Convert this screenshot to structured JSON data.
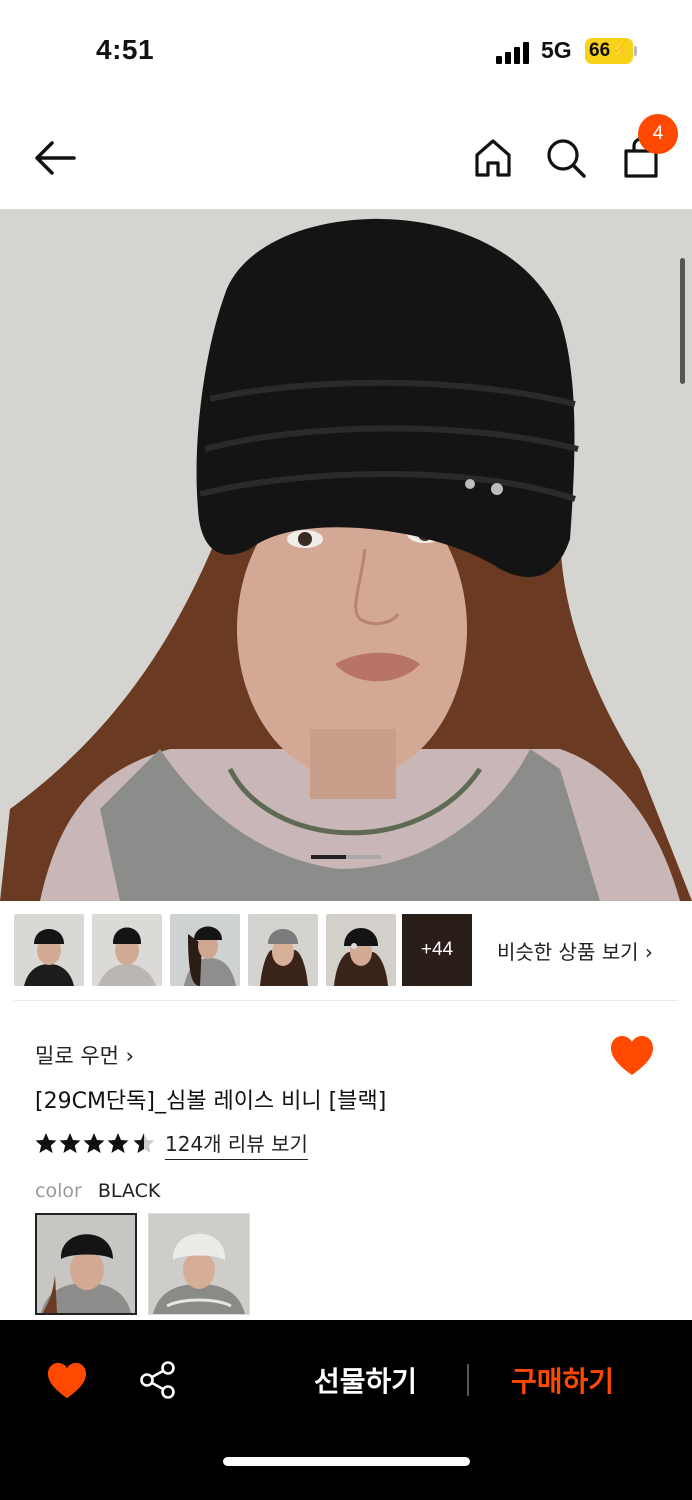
{
  "status_bar": {
    "time": "4:51",
    "network": "5G",
    "battery": "66"
  },
  "nav": {
    "cart_count": "4"
  },
  "gallery": {
    "more_count": "+44",
    "similar_label": "비슷한 상품 보기 ›"
  },
  "product": {
    "brand": "밀로 우먼 ›",
    "name": "[29CM단독]_심볼 레이스 비니 [블랙]",
    "rating": 4.5,
    "review_link": "124개 리뷰 보기",
    "color_label": "color",
    "color_value": "BLACK"
  },
  "bottom_bar": {
    "gift_label": "선물하기",
    "buy_label": "구매하기"
  },
  "colors": {
    "accent": "#ff4800",
    "bar": "#000000"
  }
}
